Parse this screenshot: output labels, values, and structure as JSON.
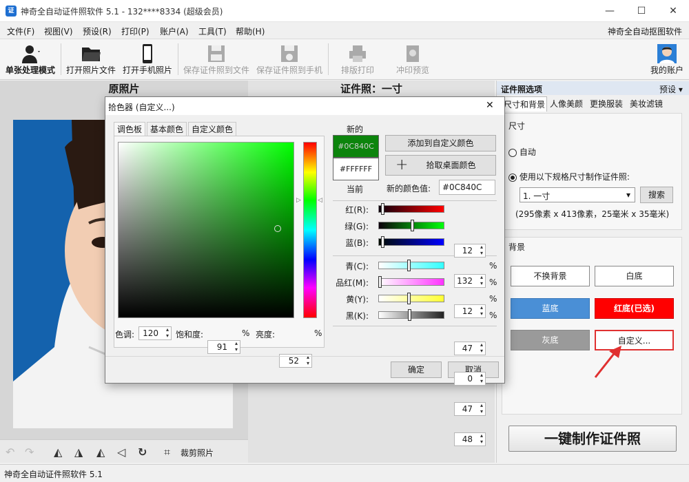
{
  "window": {
    "title": "神奇全自动证件照软件 5.1 - 132****8334 (超级会员)",
    "icon": "证",
    "minimize": "—",
    "maximize": "☐",
    "close": "✕"
  },
  "menu": {
    "items": [
      "文件(F)",
      "视图(V)",
      "预设(R)",
      "打印(P)",
      "账户(A)",
      "工具(T)",
      "帮助(H)"
    ],
    "brand": "神奇全自动抠图软件"
  },
  "toolbar": {
    "mode": "单张处理模式",
    "open_file": "打开照片文件",
    "open_phone": "打开手机照片",
    "save_file": "保存证件照到文件",
    "save_phone": "保存证件照到手机",
    "layout_print": "排版打印",
    "print_preview": "冲印预览",
    "account": "我的账户"
  },
  "left": {
    "title": "原照片",
    "crop": "裁剪照片"
  },
  "middle": {
    "title": "证件照：一寸"
  },
  "right": {
    "title": "证件照选项",
    "preset": "预设",
    "tabs": [
      "尺寸和背景",
      "人像美颜",
      "更换服装",
      "美妆滤镜"
    ],
    "size": {
      "group": "尺寸",
      "auto": "自动",
      "custom": "使用以下规格尺寸制作证件照:",
      "selected": "1. 一寸",
      "search": "搜索",
      "desc": "(295像素 x 413像素，25毫米 x 35毫米)"
    },
    "background": {
      "group": "背景",
      "keep": "不换背景",
      "white": "白底",
      "blue": "蓝底",
      "red": "红底(已选)",
      "gray": "灰底",
      "custom": "自定义...",
      "blue_color": "#4a8fd6",
      "red_color": "#ff0000",
      "gray_color": "#9a9a9a"
    },
    "make": "一键制作证件照"
  },
  "status": "神奇全自动证件照软件 5.1",
  "dialog": {
    "title": "拾色器 (自定义...)",
    "close": "✕",
    "tabs": [
      "调色板",
      "基本颜色",
      "自定义颜色"
    ],
    "new_label": "新的",
    "current_label": "当前",
    "new_hex": "#0C840C",
    "current_hex": "#FFFFFF",
    "new_color": "#0C840C",
    "current_color": "#FFFFFF",
    "add_custom": "添加到自定义颜色",
    "pick_screen": "拾取桌面颜色",
    "new_value_label": "新的颜色值:",
    "new_value": "#0C840C",
    "rgb": [
      {
        "label": "红(R):",
        "value": "12",
        "fraction": 0.047
      },
      {
        "label": "绿(G):",
        "value": "132",
        "fraction": 0.518
      },
      {
        "label": "蓝(B):",
        "value": "12",
        "fraction": 0.047
      }
    ],
    "cmyk": [
      {
        "label": "青(C):",
        "value": "47",
        "unit": "%",
        "fraction": 0.47
      },
      {
        "label": "品红(M):",
        "value": "0",
        "unit": "%",
        "fraction": 0
      },
      {
        "label": "黄(Y):",
        "value": "47",
        "unit": "%",
        "fraction": 0.47
      },
      {
        "label": "黑(K):",
        "value": "48",
        "unit": "%",
        "fraction": 0.48
      }
    ],
    "hsl": {
      "hue_label": "色调:",
      "hue": "120",
      "sat_label": "饱和度:",
      "sat": "91",
      "sat_unit": "%",
      "lum_label": "亮度:",
      "lum": "52",
      "lum_unit": "%"
    },
    "ok": "确定",
    "cancel": "取消"
  }
}
